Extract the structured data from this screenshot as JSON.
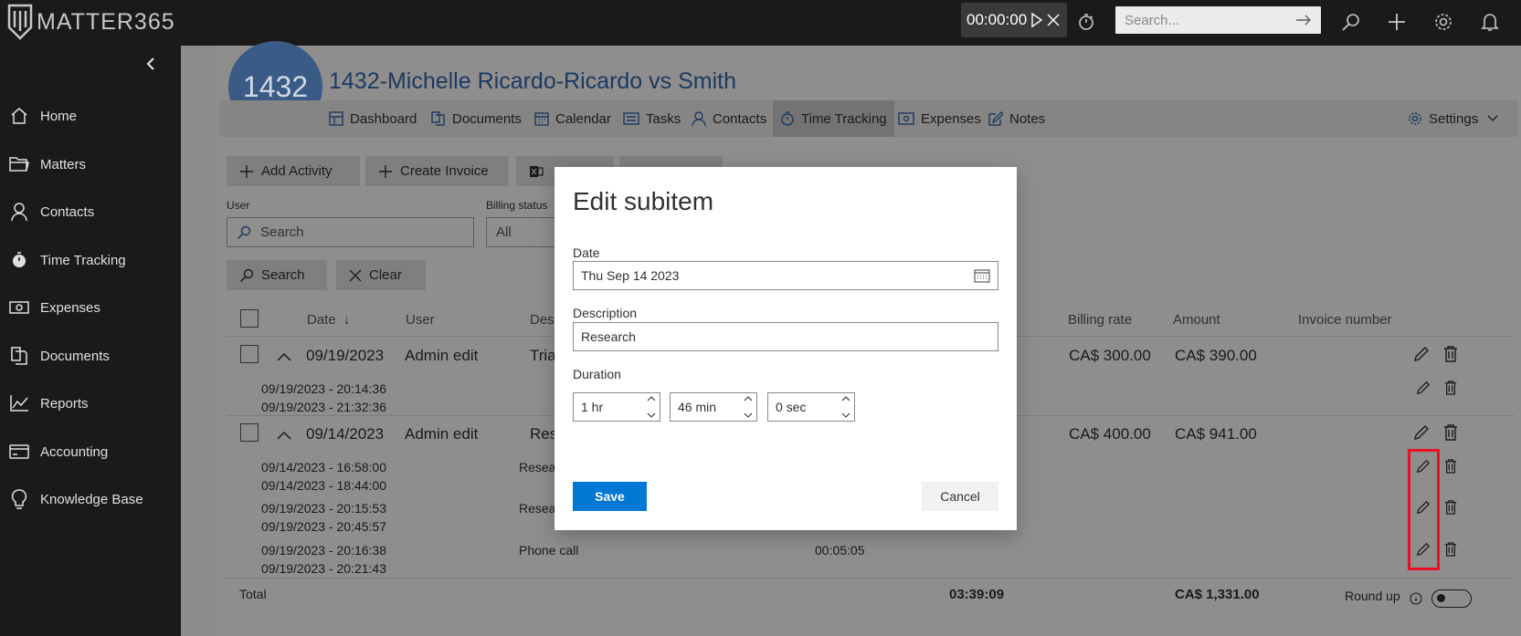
{
  "app": {
    "logo_text": "MATTER365"
  },
  "topbar": {
    "timer": "00:00:00",
    "search_placeholder": "Search..."
  },
  "sidebar": {
    "items": [
      {
        "label": "Home",
        "icon": "home-icon"
      },
      {
        "label": "Matters",
        "icon": "folder-icon"
      },
      {
        "label": "Contacts",
        "icon": "person-icon"
      },
      {
        "label": "Time Tracking",
        "icon": "stopwatch-icon"
      },
      {
        "label": "Expenses",
        "icon": "money-icon"
      },
      {
        "label": "Documents",
        "icon": "documents-icon"
      },
      {
        "label": "Reports",
        "icon": "chart-icon"
      },
      {
        "label": "Accounting",
        "icon": "card-icon"
      },
      {
        "label": "Knowledge Base",
        "icon": "lightbulb-icon"
      }
    ]
  },
  "matter": {
    "avatar_number": "1432",
    "title": "1432-Michelle Ricardo-Ricardo vs Smith"
  },
  "tabs": {
    "dashboard": "Dashboard",
    "documents": "Documents",
    "calendar": "Calendar",
    "tasks": "Tasks",
    "contacts": "Contacts",
    "time_tracking": "Time Tracking",
    "expenses": "Expenses",
    "notes": "Notes",
    "settings": "Settings"
  },
  "toolbar": {
    "add_activity": "Add Activity",
    "create_invoice": "Create Invoice"
  },
  "filters": {
    "user_label": "User",
    "user_placeholder": "Search",
    "billing_status_label": "Billing status",
    "billing_status_value": "All",
    "search_button": "Search",
    "clear_button": "Clear"
  },
  "table": {
    "headers": {
      "date": "Date",
      "user": "User",
      "description": "Desc",
      "billing_rate": "Billing rate",
      "amount": "Amount",
      "invoice_number": "Invoice number"
    },
    "rows": [
      {
        "date": "09/19/2023",
        "user": "Admin edit",
        "description": "Tria",
        "billing_rate": "CA$ 300.00",
        "amount": "CA$ 390.00",
        "subitems": [
          {
            "start": "09/19/2023 - 20:14:36",
            "end": "09/19/2023 - 21:32:36"
          }
        ]
      },
      {
        "date": "09/14/2023",
        "user": "Admin edit",
        "description": "Res",
        "billing_rate": "CA$ 400.00",
        "amount": "CA$ 941.00",
        "subitems": [
          {
            "start": "09/14/2023 - 16:58:00",
            "end": "09/14/2023 - 18:44:00",
            "description": "Resear"
          },
          {
            "start": "09/19/2023 - 20:15:53",
            "end": "09/19/2023 - 20:45:57",
            "description": "Resear"
          },
          {
            "start": "09/19/2023 - 20:16:38",
            "end": "09/19/2023 - 20:21:43",
            "description": "Phone call",
            "duration": "00:05:05"
          }
        ]
      }
    ],
    "footer": {
      "total_label": "Total",
      "total_duration": "03:39:09",
      "total_amount": "CA$ 1,331.00",
      "round_up_label": "Round up"
    }
  },
  "modal": {
    "title": "Edit subitem",
    "date_label": "Date",
    "date_value": "Thu Sep 14 2023",
    "description_label": "Description",
    "description_value": "Research",
    "duration_label": "Duration",
    "hours_value": "1 hr",
    "minutes_value": "46 min",
    "seconds_value": "0 sec",
    "save_label": "Save",
    "cancel_label": "Cancel"
  },
  "colors": {
    "primary": "#0078d4",
    "sidebar_bg": "#1b1a19",
    "highlight": "#e81123",
    "avatar": "#3a5b86"
  }
}
